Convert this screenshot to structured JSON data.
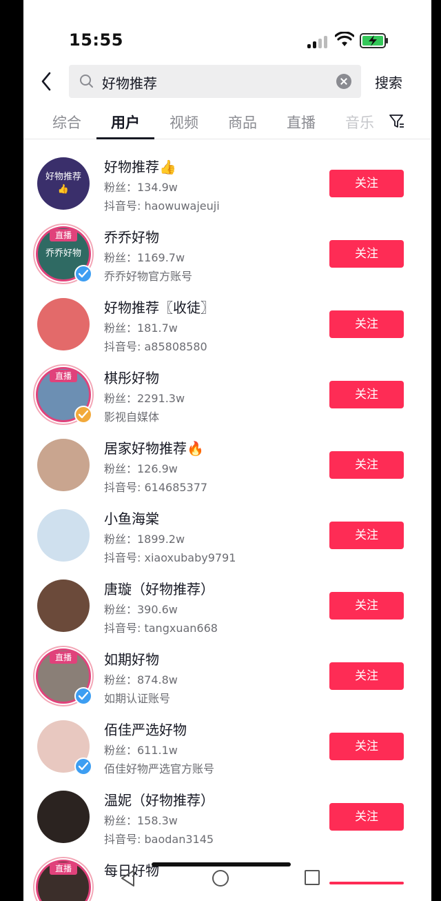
{
  "status_bar": {
    "time": "15:55"
  },
  "search": {
    "query": "好物推荐",
    "submit_label": "搜索"
  },
  "tabs": [
    {
      "label": "综合",
      "active": false
    },
    {
      "label": "用户",
      "active": true
    },
    {
      "label": "视频",
      "active": false
    },
    {
      "label": "商品",
      "active": false
    },
    {
      "label": "直播",
      "active": false
    },
    {
      "label": "音乐",
      "active": false
    }
  ],
  "live_badge": "直播",
  "follow_label": "关注",
  "users": [
    {
      "name": "好物推荐👍",
      "fans": "粉丝：134.9w",
      "sub": "抖音号: haowuwajeuji",
      "live": false,
      "verified": null,
      "avatar_text": "好物推荐👍",
      "avatar_color": "#3a2f6b"
    },
    {
      "name": "乔乔好物",
      "fans": "粉丝：1169.7w",
      "sub": "乔乔好物官方账号",
      "live": true,
      "verified": "blue",
      "avatar_text": "乔乔好物",
      "avatar_color": "#2f6a63"
    },
    {
      "name": "好物推荐〖收徒〗",
      "fans": "粉丝：181.7w",
      "sub": "抖音号: a85808580",
      "live": false,
      "verified": null,
      "avatar_text": "",
      "avatar_color": "#e36a6a"
    },
    {
      "name": "棋彤好物",
      "fans": "粉丝：2291.3w",
      "sub": "影视自媒体",
      "live": true,
      "verified": "gold",
      "avatar_text": "",
      "avatar_color": "#6c8fb3"
    },
    {
      "name": "居家好物推荐🔥",
      "fans": "粉丝：126.9w",
      "sub": "抖音号: 614685377",
      "live": false,
      "verified": null,
      "avatar_text": "",
      "avatar_color": "#c9a58f"
    },
    {
      "name": "小鱼海棠",
      "fans": "粉丝：1899.2w",
      "sub": "抖音号: xiaoxubaby9791",
      "live": false,
      "verified": null,
      "avatar_text": "",
      "avatar_color": "#cfe0ee"
    },
    {
      "name": "唐璇（好物推荐）",
      "fans": "粉丝：390.6w",
      "sub": "抖音号: tangxuan668",
      "live": false,
      "verified": null,
      "avatar_text": "",
      "avatar_color": "#6b4a3a"
    },
    {
      "name": "如期好物",
      "fans": "粉丝：874.8w",
      "sub": "如期认证账号",
      "live": true,
      "verified": "blue",
      "avatar_text": "",
      "avatar_color": "#8a7f77"
    },
    {
      "name": "佰佳严选好物",
      "fans": "粉丝：611.1w",
      "sub": "佰佳好物严选官方账号",
      "live": false,
      "verified": "blue",
      "avatar_text": "",
      "avatar_color": "#e8c8c0"
    },
    {
      "name": "温妮（好物推荐）",
      "fans": "粉丝：158.3w",
      "sub": "抖音号: baodan3145",
      "live": false,
      "verified": null,
      "avatar_text": "",
      "avatar_color": "#2b2320"
    },
    {
      "name": "每日好物",
      "fans": "",
      "sub": "",
      "live": true,
      "verified": null,
      "avatar_text": "",
      "avatar_color": "#3b2e2a"
    }
  ],
  "colors": {
    "accent": "#fe2c55",
    "live": "#e0427b",
    "verified_blue": "#3d9ef2",
    "verified_gold": "#f2a93b"
  }
}
